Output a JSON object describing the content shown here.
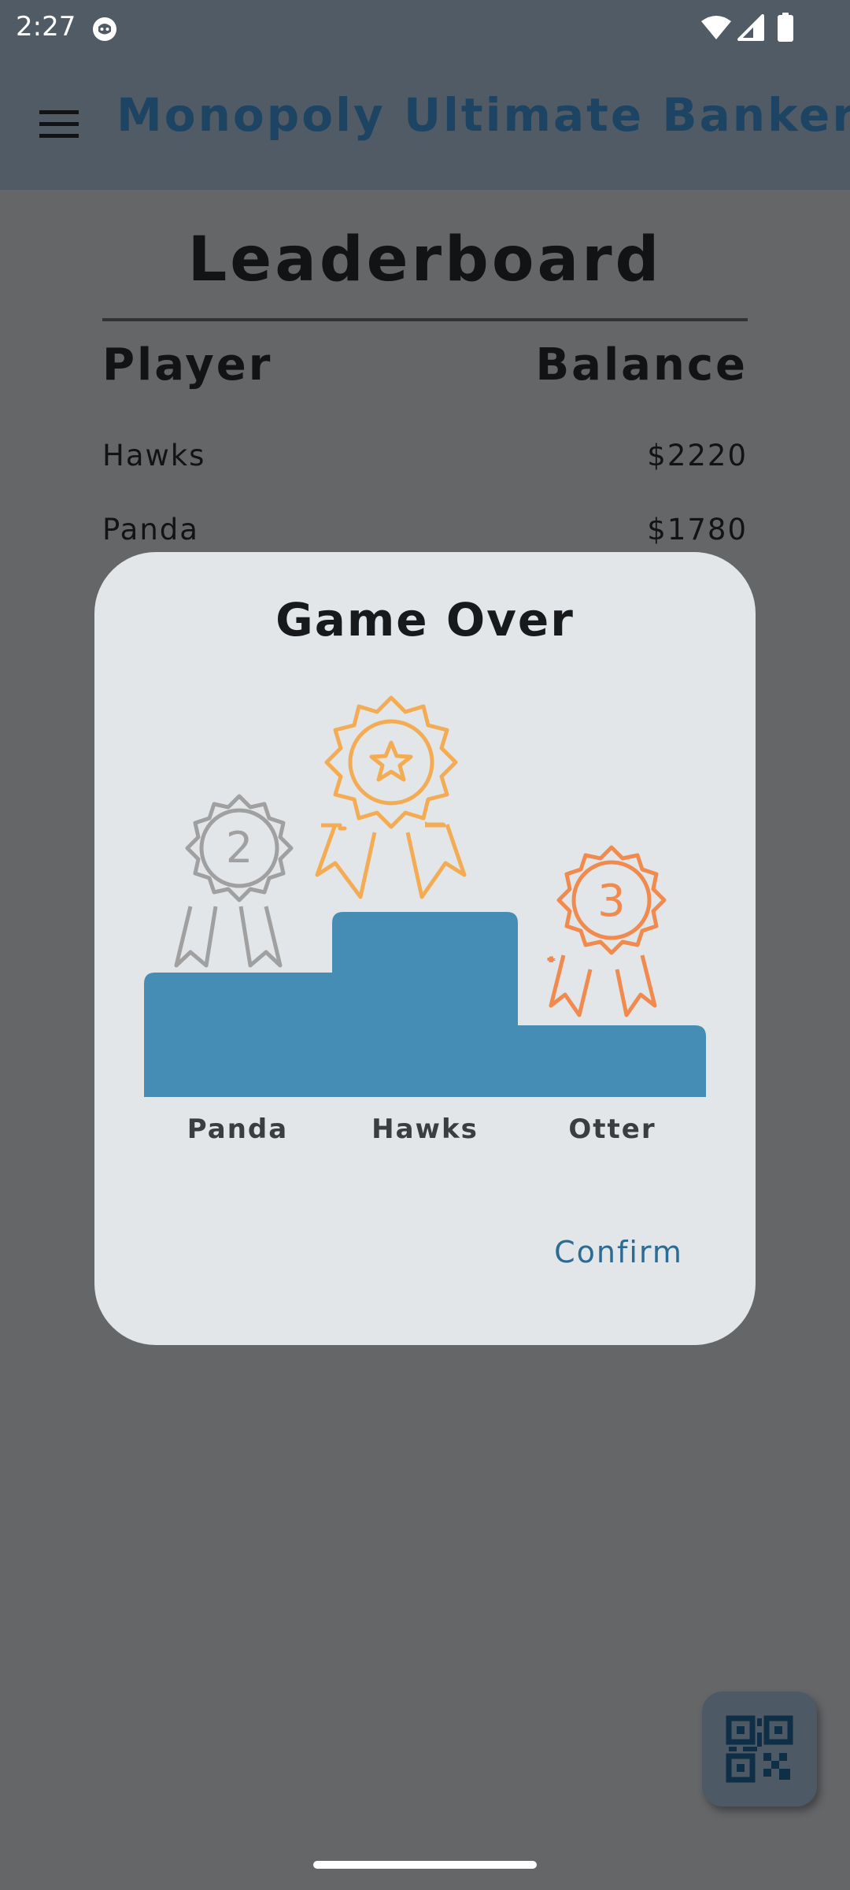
{
  "status_bar": {
    "time": "2:27",
    "icons": [
      "app-notification-icon",
      "wifi-icon",
      "signal-icon",
      "battery-icon"
    ]
  },
  "app_bar": {
    "title": "Monopoly Ultimate Banker",
    "menu_icon": "hamburger-menu-icon"
  },
  "leaderboard": {
    "title": "Leaderboard",
    "headers": {
      "player": "Player",
      "balance": "Balance"
    },
    "rows": [
      {
        "name": "Hawks",
        "balance": "$2220"
      },
      {
        "name": "Panda",
        "balance": "$1780"
      }
    ]
  },
  "dialog": {
    "title": "Game Over",
    "podium": [
      {
        "place": 2,
        "name": "Panda",
        "badge_text": "2",
        "badge_color": "#a0a0a0"
      },
      {
        "place": 1,
        "name": "Hawks",
        "badge_text": "",
        "badge_color": "#f4ac54"
      },
      {
        "place": 3,
        "name": "Otter",
        "badge_text": "3",
        "badge_color": "#f08a4e"
      }
    ],
    "podium_color": "#468db5",
    "confirm_label": "Confirm"
  },
  "fab": {
    "icon": "qr-code-icon"
  },
  "colors": {
    "scrim": "#656668",
    "app_bar": "#515b66",
    "title_text": "#1d4462",
    "dialog_bg": "#e2e6e9",
    "accent": "#2c6b93"
  }
}
